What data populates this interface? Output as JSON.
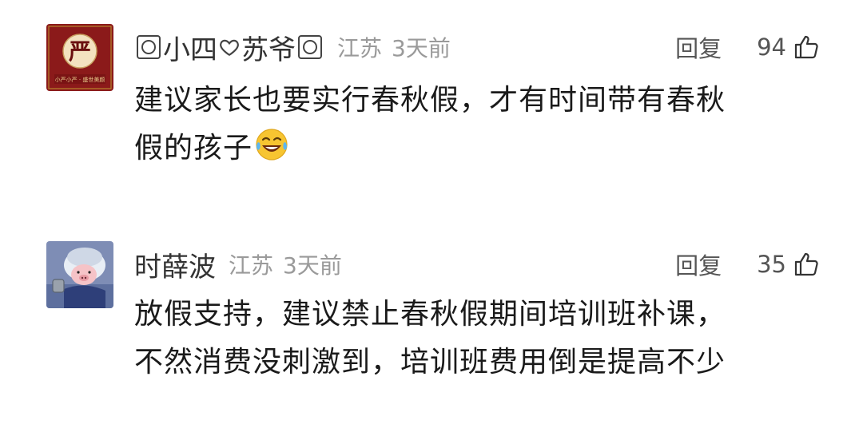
{
  "comments": [
    {
      "username_parts": [
        "小四",
        "苏爷"
      ],
      "location": "江苏",
      "time": "3天前",
      "reply_label": "回复",
      "likes": "94",
      "text_lines": [
        "建议家长也要实行春秋假，才有时间带有春秋",
        "假的孩子"
      ],
      "emoji": "laughing-tears-emoji",
      "avatar_text": "严",
      "avatar_caption": "小严小严 · 盛世美颜"
    },
    {
      "username": "时薛波",
      "location": "江苏",
      "time": "3天前",
      "reply_label": "回复",
      "likes": "35",
      "text_lines": [
        "放假支持，建议禁止春秋假期间培训班补课，",
        "不然消费没刺激到，培训班费用倒是提高不少"
      ]
    }
  ],
  "colors": {
    "meta": "#9a9a9a",
    "avatar1_bg": "#8b1a1a",
    "avatar2_bg": "#6f7fa8"
  }
}
